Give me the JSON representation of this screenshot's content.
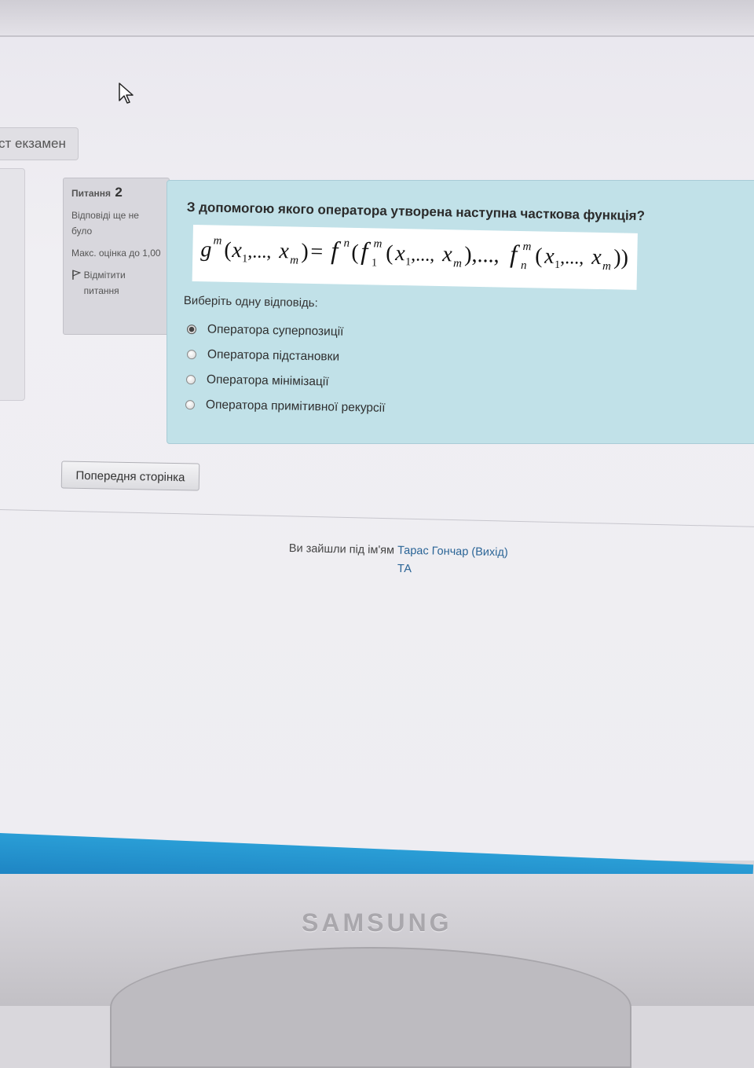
{
  "crumb": {
    "label": "ст екзамен"
  },
  "question_info": {
    "label": "Питання",
    "number": "2",
    "status": "Відповіді ще не було",
    "max_mark": "Макс. оцінка до 1,00",
    "flag_label": "Відмітити питання"
  },
  "question": {
    "text": "З допомогою якого оператора утворена наступна часткова функція?",
    "choose_label": "Виберіть одну відповідь:",
    "answers": [
      {
        "label": "Оператора суперпозиції",
        "selected": true
      },
      {
        "label": "Оператора підстановки",
        "selected": false
      },
      {
        "label": "Оператора мінімізації",
        "selected": false
      },
      {
        "label": "Оператора примітивної рекурсії",
        "selected": false
      }
    ]
  },
  "nav": {
    "prev_label": "Попередня сторінка"
  },
  "footer": {
    "logged_in_prefix": "Ви зайшли під ім'ям",
    "user_name": "Тарас Гончар",
    "logout_label": "(Вихід)",
    "extra_link": "ТА"
  },
  "monitor": {
    "brand": "SAMSUNG"
  },
  "colors": {
    "question_bg": "#c1e1e8",
    "info_bg": "#d8d7dd",
    "link": "#2a6496",
    "taskbar": "#1f87c5"
  }
}
